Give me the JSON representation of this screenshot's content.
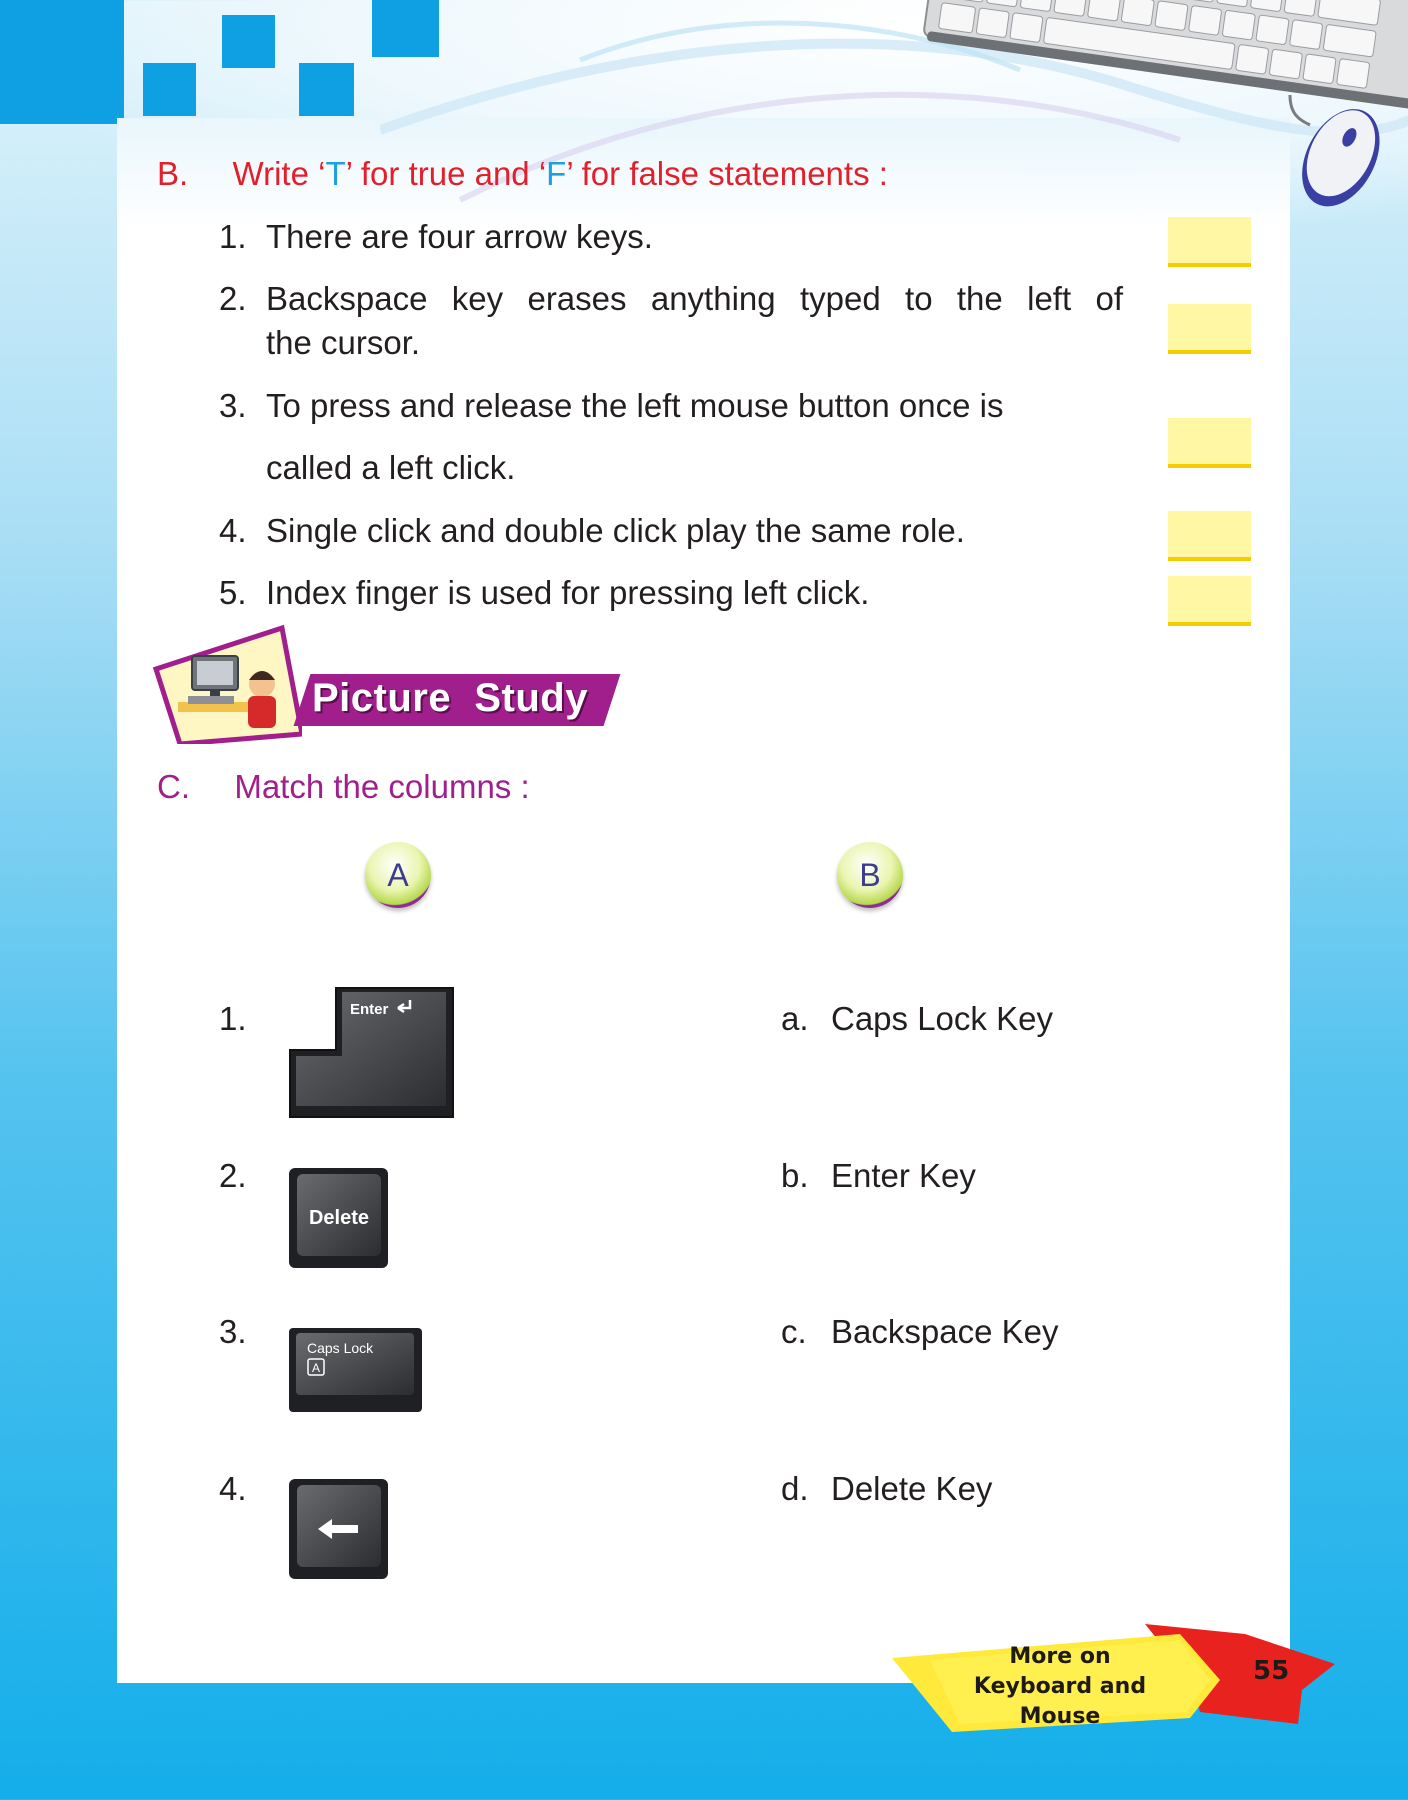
{
  "section_b": {
    "letter": "B.",
    "heading_pre": "Write ‘",
    "heading_t": "T",
    "heading_mid": "’ for true and ‘",
    "heading_f": "F",
    "heading_post": "’ for false statements :",
    "items": [
      {
        "num": "1.",
        "line1": "There are four arrow keys.",
        "line2": ""
      },
      {
        "num": "2.",
        "line1": "Backspace key erases anything typed to the left of",
        "line2": "the cursor."
      },
      {
        "num": "3.",
        "line1": "To press and release the left mouse button once is",
        "line2": "called a left click."
      },
      {
        "num": "4.",
        "line1": "Single click and double click play the same role.",
        "line2": ""
      },
      {
        "num": "5.",
        "line1": "Index finger is used for pressing left click.",
        "line2": ""
      }
    ]
  },
  "picture_study": {
    "title": "Picture  Study"
  },
  "section_c": {
    "letter": "C.",
    "heading": "Match the columns :",
    "col_a": "A",
    "col_b": "B",
    "left": [
      {
        "num": "1.",
        "key_label": "Enter"
      },
      {
        "num": "2.",
        "key_label": "Delete"
      },
      {
        "num": "3.",
        "key_label": "Caps Lock"
      },
      {
        "num": "4.",
        "key_label": ""
      }
    ],
    "right": [
      {
        "letter": "a.",
        "text": "Caps Lock Key"
      },
      {
        "letter": "b.",
        "text": "Enter Key"
      },
      {
        "letter": "c.",
        "text": "Backspace Key"
      },
      {
        "letter": "d.",
        "text": "Delete Key"
      }
    ],
    "caps_glyph": "A"
  },
  "footer": {
    "chapter_line1": "More on",
    "chapter_line2": "Keyboard and Mouse",
    "page_number": "55"
  },
  "colors": {
    "section_b_heading": "#e2202c",
    "tf_letters": "#1e9fe0",
    "section_c_heading": "#a01f8c",
    "answer_box": "#fff7a3",
    "answer_box_line": "#f4cc00",
    "background_blue": "#14aeea"
  }
}
